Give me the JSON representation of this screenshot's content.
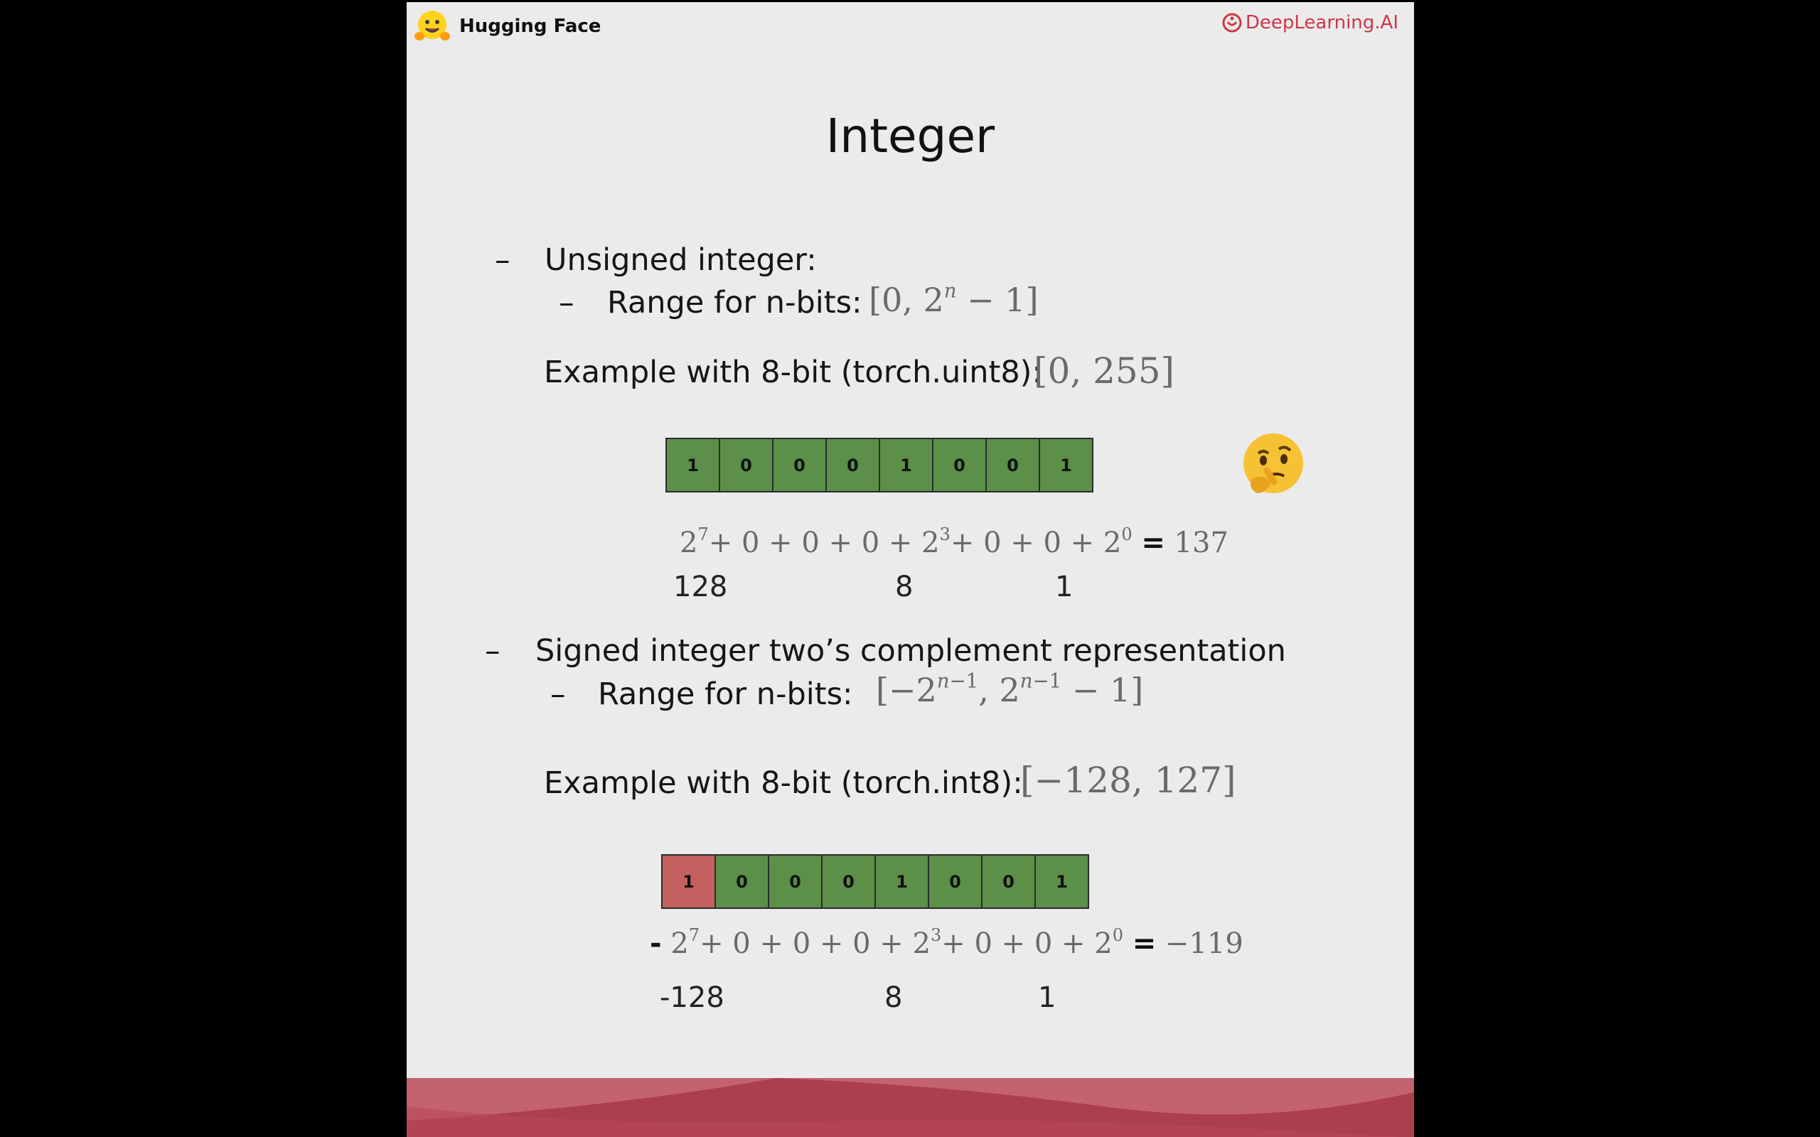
{
  "header": {
    "left_logo": {
      "icon": "hugging-face-icon",
      "text": "Hugging Face"
    },
    "right_logo": {
      "icon": "deeplearning-ai-icon",
      "text": "DeepLearning.AI"
    }
  },
  "slide": {
    "title": "Integer",
    "unsigned": {
      "bullet": "Unsigned integer:",
      "range_label": "Range for n-bits:",
      "example_label": "Example with 8-bit (torch.uint8):",
      "bits": [
        "1",
        "0",
        "0",
        "0",
        "1",
        "0",
        "0",
        "1"
      ],
      "result": "137",
      "positional_values": [
        "128",
        "8",
        "1"
      ]
    },
    "signed": {
      "bullet": "Signed integer two’s complement representation",
      "range_label": "Range for n-bits:",
      "example_label": "Example with 8-bit (torch.int8):",
      "bits": [
        "1",
        "0",
        "0",
        "0",
        "1",
        "0",
        "0",
        "1"
      ],
      "result": "−119",
      "positional_values": [
        "-128",
        "8",
        "1"
      ]
    },
    "emoji": "thinking-face-icon"
  },
  "colors": {
    "bit_green": "#5c8f48",
    "bit_red": "#c46060",
    "brand_red": "#d23545",
    "footer_red": "#b0414f"
  }
}
